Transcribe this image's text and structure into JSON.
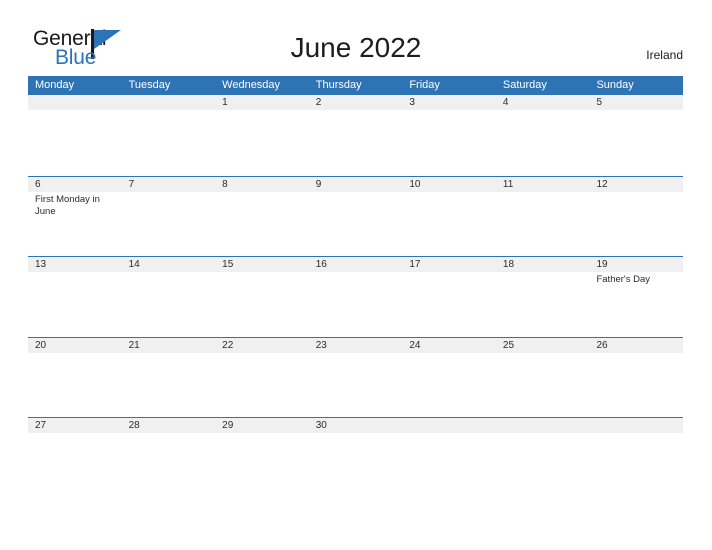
{
  "brand": {
    "name_part1": "General",
    "name_part2": "Blue",
    "mark": "triangle-logo"
  },
  "header": {
    "title": "June 2022",
    "region": "Ireland"
  },
  "calendar": {
    "weekdays": [
      "Monday",
      "Tuesday",
      "Wednesday",
      "Thursday",
      "Friday",
      "Saturday",
      "Sunday"
    ],
    "colors": {
      "header_blue": "#2e74b5",
      "band_gray": "#f0f0f0",
      "text": "#2b2b2b",
      "brand_blue": "#2b74b8"
    },
    "weeks": [
      {
        "days": [
          {
            "num": "",
            "events": []
          },
          {
            "num": "",
            "events": []
          },
          {
            "num": "1",
            "events": []
          },
          {
            "num": "2",
            "events": []
          },
          {
            "num": "3",
            "events": []
          },
          {
            "num": "4",
            "events": []
          },
          {
            "num": "5",
            "events": []
          }
        ]
      },
      {
        "days": [
          {
            "num": "6",
            "events": [
              "First Monday in June"
            ]
          },
          {
            "num": "7",
            "events": []
          },
          {
            "num": "8",
            "events": []
          },
          {
            "num": "9",
            "events": []
          },
          {
            "num": "10",
            "events": []
          },
          {
            "num": "11",
            "events": []
          },
          {
            "num": "12",
            "events": []
          }
        ]
      },
      {
        "days": [
          {
            "num": "13",
            "events": []
          },
          {
            "num": "14",
            "events": []
          },
          {
            "num": "15",
            "events": []
          },
          {
            "num": "16",
            "events": []
          },
          {
            "num": "17",
            "events": []
          },
          {
            "num": "18",
            "events": []
          },
          {
            "num": "19",
            "events": [
              "Father's Day"
            ]
          }
        ]
      },
      {
        "days": [
          {
            "num": "20",
            "events": []
          },
          {
            "num": "21",
            "events": []
          },
          {
            "num": "22",
            "events": []
          },
          {
            "num": "23",
            "events": []
          },
          {
            "num": "24",
            "events": []
          },
          {
            "num": "25",
            "events": []
          },
          {
            "num": "26",
            "events": []
          }
        ]
      },
      {
        "days": [
          {
            "num": "27",
            "events": []
          },
          {
            "num": "28",
            "events": []
          },
          {
            "num": "29",
            "events": []
          },
          {
            "num": "30",
            "events": []
          },
          {
            "num": "",
            "events": []
          },
          {
            "num": "",
            "events": []
          },
          {
            "num": "",
            "events": []
          }
        ]
      }
    ]
  }
}
